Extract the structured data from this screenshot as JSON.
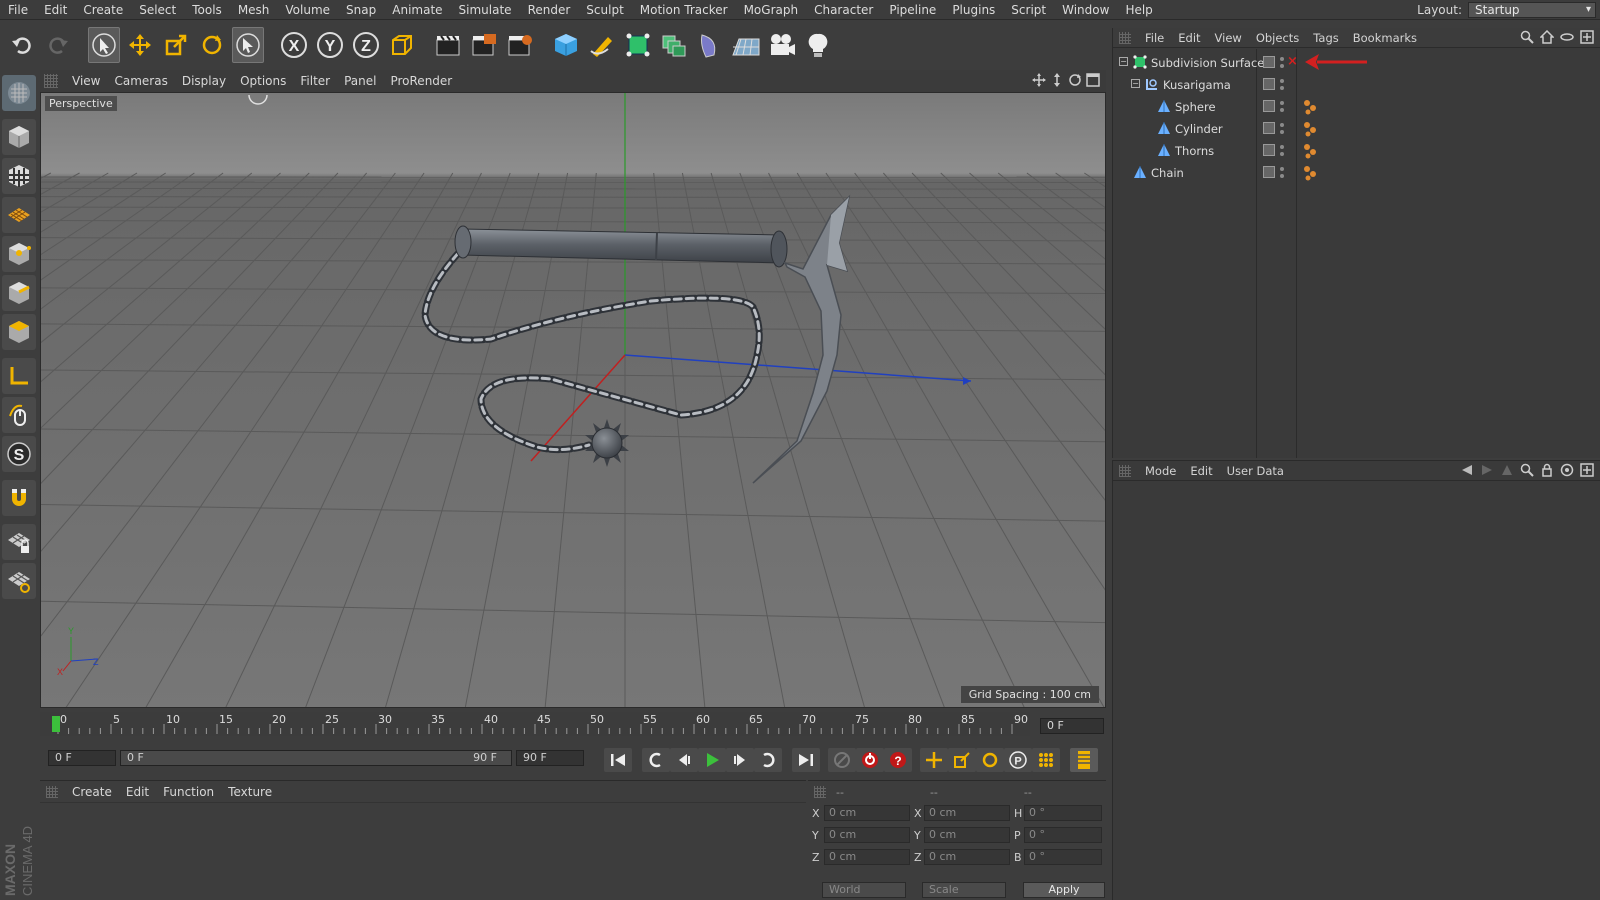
{
  "menubar": {
    "items": [
      "File",
      "Edit",
      "Create",
      "Select",
      "Tools",
      "Mesh",
      "Volume",
      "Snap",
      "Animate",
      "Simulate",
      "Render",
      "Sculpt",
      "Motion Tracker",
      "MoGraph",
      "Character",
      "Pipeline",
      "Plugins",
      "Script",
      "Window",
      "Help"
    ],
    "layout_label": "Layout:",
    "layout_value": "Startup"
  },
  "toolbar": {
    "icons": [
      "undo-icon",
      "redo-icon",
      "live-selection-icon",
      "move-icon",
      "scale-icon",
      "rotate-icon",
      "select-icon",
      "x-axis-lock-icon",
      "y-axis-lock-icon",
      "z-axis-lock-icon",
      "coordinate-system-icon",
      "render-view-icon",
      "render-picture-viewer-icon",
      "render-settings-icon",
      "cube-primitive-icon",
      "pen-spline-icon",
      "subdivision-surface-icon",
      "array-cloner-icon",
      "deformer-icon",
      "floor-icon",
      "camera-icon",
      "light-icon"
    ],
    "axis_labels": [
      "X",
      "Y",
      "Z"
    ]
  },
  "viewport": {
    "menu": [
      "View",
      "Cameras",
      "Display",
      "Options",
      "Filter",
      "Panel",
      "ProRender"
    ],
    "label": "Perspective",
    "grid_spacing": "Grid Spacing : 100 cm",
    "axis_y": "Y",
    "axis_z": "Z",
    "axis_x": "X"
  },
  "timeline": {
    "ticks": [
      "0",
      "5",
      "10",
      "15",
      "20",
      "25",
      "30",
      "35",
      "40",
      "45",
      "50",
      "55",
      "60",
      "65",
      "70",
      "75",
      "80",
      "85",
      "90"
    ],
    "current_frame": "0 F",
    "start_field": "0 F",
    "range_start": "0 F",
    "range_end": "90 F",
    "end_field": "90 F"
  },
  "material_panel": {
    "menu": [
      "Create",
      "Edit",
      "Function",
      "Texture"
    ]
  },
  "coordinates": {
    "headers": [
      "--",
      "--",
      "--"
    ],
    "rows": [
      {
        "a": "X",
        "v1": "0 cm",
        "b": "X",
        "v2": "0 cm",
        "c": "H",
        "v3": "0 °"
      },
      {
        "a": "Y",
        "v1": "0 cm",
        "b": "Y",
        "v2": "0 cm",
        "c": "P",
        "v3": "0 °"
      },
      {
        "a": "Z",
        "v1": "0 cm",
        "b": "Z",
        "v2": "0 cm",
        "c": "B",
        "v3": "0 °"
      }
    ],
    "mode_world": "World",
    "mode_scale": "Scale",
    "apply": "Apply"
  },
  "brand": {
    "maxon": "MAXON",
    "cinema": "CINEMA 4D"
  },
  "object_manager": {
    "menu": [
      "File",
      "Edit",
      "View",
      "Objects",
      "Tags",
      "Bookmarks"
    ],
    "objects": [
      {
        "name": "Subdivision Surface",
        "level": 0,
        "icon": "subdivision-surface-icon",
        "tag": false
      },
      {
        "name": "Kusarigama",
        "level": 1,
        "icon": "null-object-icon",
        "tag": false
      },
      {
        "name": "Sphere",
        "level": 2,
        "icon": "polygon-object-icon",
        "tag": true
      },
      {
        "name": "Cylinder",
        "level": 2,
        "icon": "polygon-object-icon",
        "tag": true
      },
      {
        "name": "Thorns",
        "level": 2,
        "icon": "polygon-object-icon",
        "tag": true
      },
      {
        "name": "Chain",
        "level": 0,
        "icon": "polygon-object-icon",
        "tag": true
      }
    ]
  },
  "attribute_manager": {
    "menu": [
      "Mode",
      "Edit",
      "User Data"
    ]
  },
  "colors": {
    "accent_red": "#d32020",
    "axis_green": "#2a9a2a",
    "axis_blue": "#2040c0",
    "axis_red": "#c02020"
  }
}
